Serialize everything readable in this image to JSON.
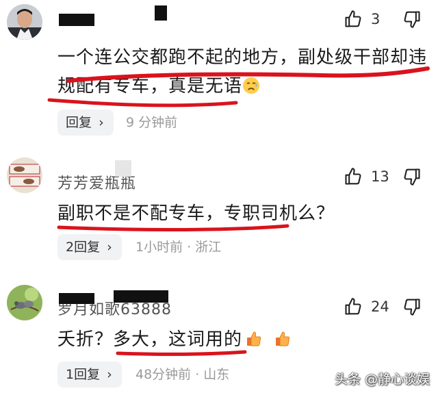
{
  "comments": [
    {
      "likes": "3",
      "text": "一个连公交都跑不起的地方，副处级干部却违",
      "text2": "规配有专车，真是无语",
      "reply_label": "回复",
      "time": "9 分钟前"
    },
    {
      "username": "芳芳爱瓶瓶",
      "likes": "13",
      "text": "副职不是不配专车，专职司机么？",
      "reply_label": "2回复",
      "time": "1小时前 · 浙江"
    },
    {
      "username": "罗月如歌63888",
      "likes": "24",
      "text": "夭折？多大，这词用的",
      "reply_label": "1回复",
      "time": "48分钟前 · 山东"
    }
  ],
  "watermark": "头条 @静心谈娱",
  "colors": {
    "underline": "#d9131d",
    "reply_bg": "#f1f2f4",
    "meta": "#999999"
  },
  "icons": [
    "thumbs-up-icon",
    "thumbs-down-icon",
    "chevron-right-icon",
    "sad-emoji",
    "thumbs-up-emoji"
  ]
}
